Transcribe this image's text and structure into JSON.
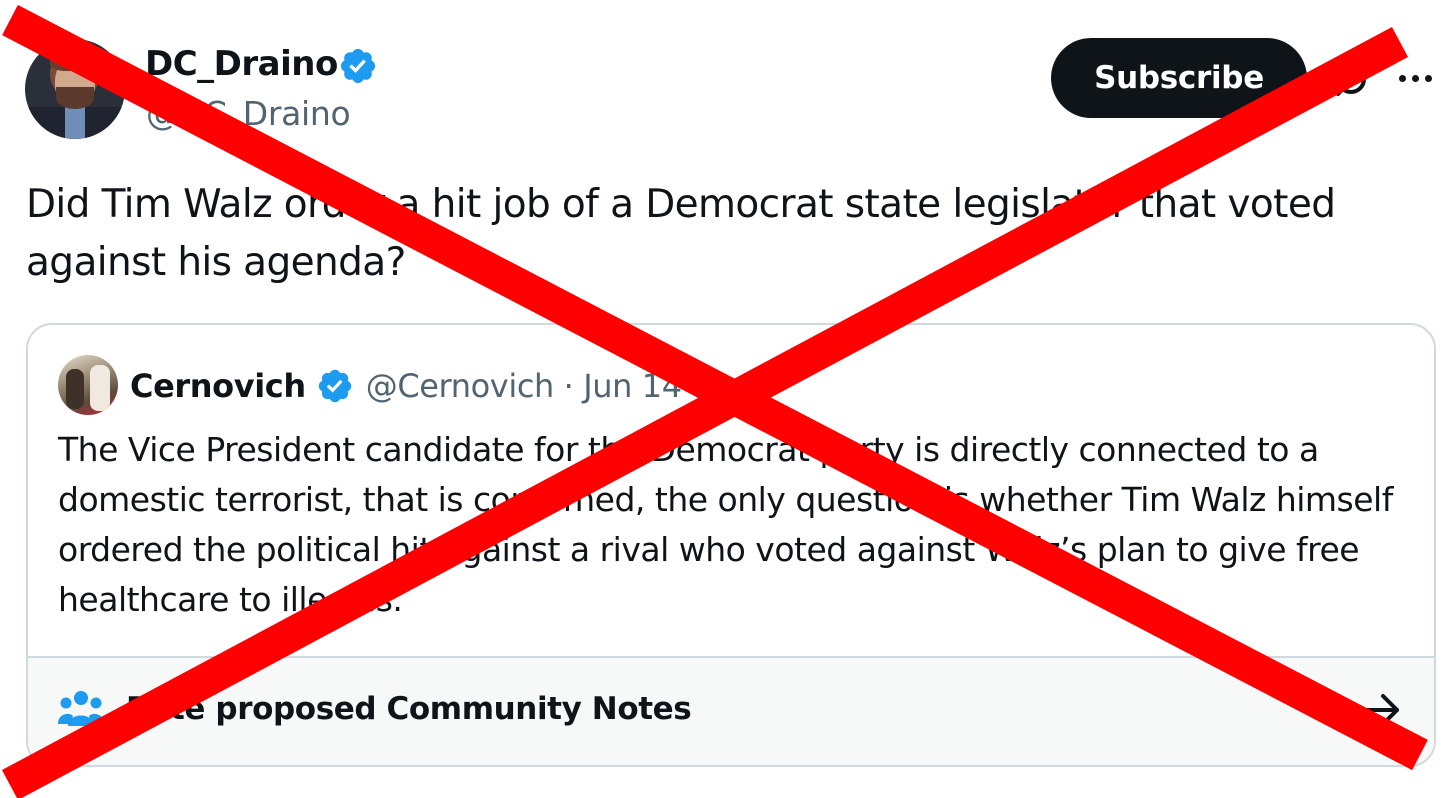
{
  "author": {
    "display_name": "DC_Draino",
    "handle": "@DC_Draino",
    "verified": true
  },
  "actions": {
    "subscribe_label": "Subscribe"
  },
  "tweet": {
    "text": "Did Tim Walz order a hit job of a Democrat state legislator that voted against his agenda?"
  },
  "quote": {
    "display_name": "Cernovich",
    "meta": "@Cernovich · Jun 14",
    "verified": true,
    "text": "The Vice President candidate for the Democrat party is directly connected to a domestic terrorist, that is confirmed, the only question is whether Tim Walz himself ordered the political hit against a rival who voted against Walz’s plan to give free healthcare to illegals."
  },
  "community_notes": {
    "label": "Rate proposed Community Notes"
  },
  "colors": {
    "text_primary": "#0f1419",
    "text_secondary": "#536471",
    "verified_blue": "#1d9bf0",
    "border": "#cfd9de",
    "cross_red": "#ff0000"
  },
  "icons": {
    "verified": "verified-badge-icon",
    "grok": "grok-icon",
    "more": "more-options-icon",
    "community_notes": "community-notes-icon",
    "arrow": "arrow-right-icon"
  }
}
